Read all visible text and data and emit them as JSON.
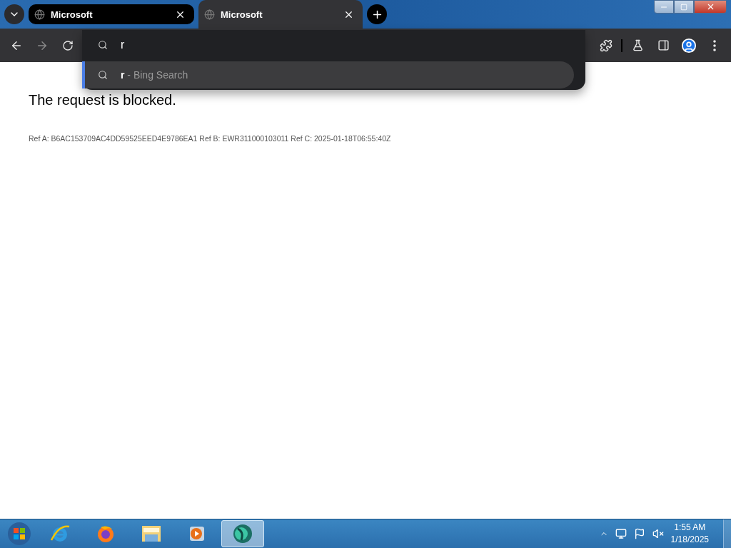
{
  "tabs": [
    {
      "title": "Microsoft",
      "selected": false
    },
    {
      "title": "Microsoft",
      "selected": true
    }
  ],
  "omnibox": {
    "value": "r",
    "suggestions": [
      {
        "match": "r",
        "text": " - Bing Search",
        "selected": true
      }
    ]
  },
  "page": {
    "heading": "The request is blocked.",
    "reference": "Ref A: B6AC153709AC4DD59525EED4E9786EA1 Ref B: EWR311000103011 Ref C: 2025-01-18T06:55:40Z"
  },
  "taskbar": {
    "apps": [
      {
        "kind": "ie",
        "selected": false
      },
      {
        "kind": "firefox",
        "selected": false
      },
      {
        "kind": "explorer",
        "selected": false
      },
      {
        "kind": "media",
        "selected": false
      },
      {
        "kind": "globe",
        "selected": true
      }
    ],
    "clock": {
      "time": "1:55 AM",
      "date": "1/18/2025"
    }
  }
}
